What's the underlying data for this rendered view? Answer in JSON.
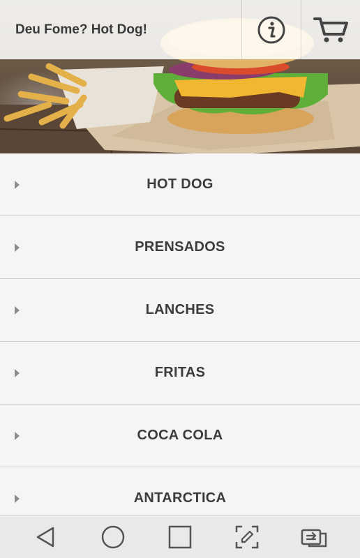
{
  "header": {
    "title": "Deu Fome? Hot Dog!",
    "info_icon": "info-icon",
    "cart_icon": "cart-icon"
  },
  "hero": {
    "image": "burger-and-fries-photo"
  },
  "menu": {
    "items": [
      {
        "label": "HOT DOG"
      },
      {
        "label": "PRENSADOS"
      },
      {
        "label": "LANCHES"
      },
      {
        "label": "FRITAS"
      },
      {
        "label": "COCA COLA"
      },
      {
        "label": "ANTARCTICA"
      }
    ]
  },
  "navbar": {
    "icons": [
      "back-icon",
      "home-icon",
      "recents-icon",
      "screenshot-edit-icon",
      "switch-app-icon"
    ]
  },
  "colors": {
    "topbar_bg": "#ffffff",
    "row_bg": "#f5f5f5",
    "row_divider": "#c9c9c9",
    "label_text": "#3c3c3c",
    "navbar_bg": "#e9e9e9"
  }
}
